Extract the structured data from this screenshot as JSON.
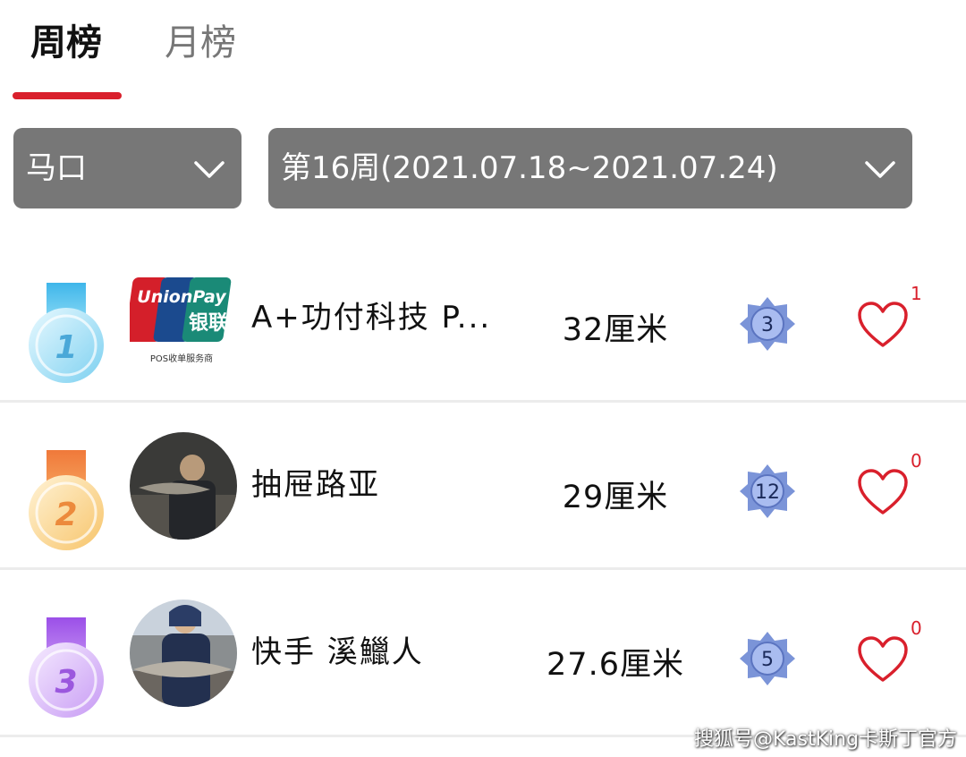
{
  "tabs": [
    {
      "label": "周榜",
      "active": true
    },
    {
      "label": "月榜",
      "active": false
    }
  ],
  "colors": {
    "accent": "#d9202c",
    "dropdown_bg": "#777777"
  },
  "filters": {
    "region": {
      "value": "马口",
      "icon": "chevron-down-icon"
    },
    "week": {
      "value": "第16周(2021.07.18~2021.07.24)",
      "icon": "chevron-down-icon"
    }
  },
  "rankings": [
    {
      "rank": "1",
      "medal_color": "blue",
      "avatar": "unionpay-logo",
      "avatar_logo_top": "UnionPay",
      "avatar_logo_cn": "银联",
      "avatar_logo_sub": "POS收单服务商",
      "name": "A+功付科技  P...",
      "length": "32厘米",
      "level": "3",
      "likes": "1"
    },
    {
      "rank": "2",
      "medal_color": "orange",
      "avatar": "user-photo",
      "name": "抽屉路亚",
      "length": "29厘米",
      "level": "12",
      "likes": "0"
    },
    {
      "rank": "3",
      "medal_color": "purple",
      "avatar": "user-photo",
      "name": "快手 溪鱲人",
      "length": "27.6厘米",
      "level": "5",
      "likes": "0"
    }
  ],
  "watermark": "搜狐号@KastKing卡斯丁官方"
}
